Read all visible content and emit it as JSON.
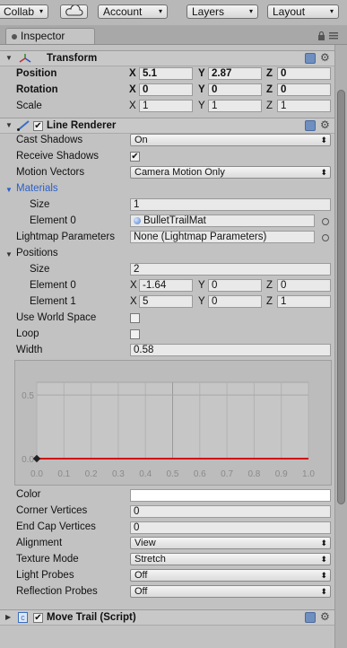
{
  "toolbar": {
    "collab_label": "Collab",
    "collab_arrow": "▾",
    "cloud_icon": "cloud-icon",
    "account_label": "Account",
    "layers_label": "Layers",
    "layout_label": "Layout",
    "arrow": "▾"
  },
  "inspector_tab": {
    "label": "Inspector",
    "lock_icon": "lock-icon",
    "menu_icon": "menu-icon"
  },
  "transform": {
    "title": "Transform",
    "fold": "▼",
    "position_label": "Position",
    "rotation_label": "Rotation",
    "scale_label": "Scale",
    "x": "X",
    "y": "Y",
    "z": "Z",
    "position": {
      "x": "5.1",
      "y": "2.87",
      "z": "0"
    },
    "rotation": {
      "x": "0",
      "y": "0",
      "z": "0"
    },
    "scale": {
      "x": "1",
      "y": "1",
      "z": "1"
    }
  },
  "line_renderer": {
    "title": "Line Renderer",
    "enabled_check": "✔",
    "fold": "▼",
    "cast_shadows_label": "Cast Shadows",
    "cast_shadows_value": "On",
    "receive_shadows_label": "Receive Shadows",
    "receive_shadows_check": "✔",
    "motion_vectors_label": "Motion Vectors",
    "motion_vectors_value": "Camera Motion Only",
    "materials_label": "Materials",
    "materials_fold": "▼",
    "size_label": "Size",
    "materials_size": "1",
    "element0_label": "Element 0",
    "element0_value": "BulletTrailMat",
    "lightmap_label": "Lightmap Parameters",
    "lightmap_value": "None (Lightmap Parameters)",
    "positions_label": "Positions",
    "positions_fold": "▼",
    "positions_size": "2",
    "pos_element0_label": "Element 0",
    "pos_element1_label": "Element 1",
    "pos_element0": {
      "x": "-1.64",
      "y": "0",
      "z": "0"
    },
    "pos_element1": {
      "x": "5",
      "y": "0",
      "z": "1"
    },
    "use_world_space_label": "Use World Space",
    "loop_label": "Loop",
    "width_label": "Width",
    "width_value": "0.58",
    "color_label": "Color",
    "corner_vertices_label": "Corner Vertices",
    "corner_vertices_value": "0",
    "end_cap_vertices_label": "End Cap Vertices",
    "end_cap_vertices_value": "0",
    "alignment_label": "Alignment",
    "alignment_value": "View",
    "texture_mode_label": "Texture Mode",
    "texture_mode_value": "Stretch",
    "light_probes_label": "Light Probes",
    "light_probes_value": "Off",
    "reflection_probes_label": "Reflection Probes",
    "reflection_probes_value": "Off",
    "popup_arrow": "⬍",
    "line_color": "#d01010"
  },
  "move_trail": {
    "title": "Move Trail (Script)",
    "enabled_check": "✔",
    "fold": "▶"
  },
  "chart_data": {
    "type": "line",
    "title": "",
    "xlabel": "",
    "ylabel": "",
    "x_ticks": [
      "0.0",
      "0.1",
      "0.2",
      "0.3",
      "0.4",
      "0.5",
      "0.6",
      "0.7",
      "0.8",
      "0.9",
      "1.0"
    ],
    "y_ticks": [
      "0.5",
      "0.0"
    ],
    "xlim": [
      0,
      1
    ],
    "ylim": [
      0,
      0.6
    ],
    "series": [
      {
        "points": [
          [
            0.0,
            0.0
          ],
          [
            1.0,
            0.0
          ]
        ]
      }
    ],
    "grid": true
  }
}
